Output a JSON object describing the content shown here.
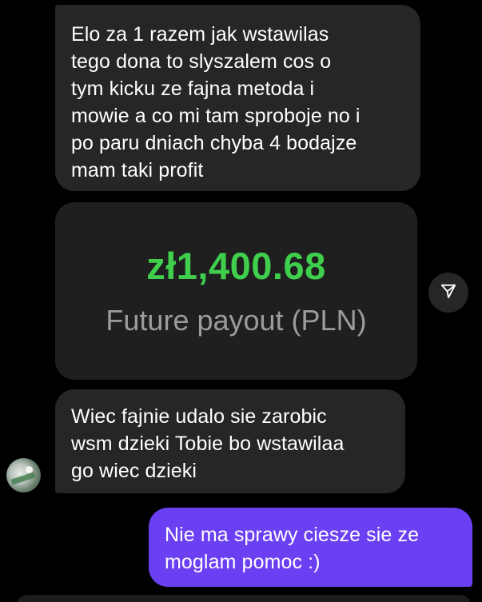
{
  "messages": [
    {
      "direction": "incoming",
      "lines": [
        "Elo za 1 razem jak wstawilas",
        "tego dona to slyszalem cos o",
        "tym kicku ze fajna metoda i",
        "mowie a co mi tam sproboje no i",
        "po paru dniach chyba 4 bodajze",
        "mam taki profit"
      ]
    },
    {
      "direction": "incoming",
      "lines": [
        "Wiec fajnie udalo sie zarobic",
        "wsm dzieki Tobie bo wstawilaa",
        "go wiec dzieki"
      ]
    },
    {
      "direction": "outgoing",
      "lines": [
        "Nie ma sprawy ciesze sie ze",
        "moglam pomoc :)"
      ]
    }
  ],
  "payout_card": {
    "amount": "zł1,400.68",
    "label": "Future payout (PLN)"
  },
  "icons": {
    "share": "paper-plane-icon",
    "avatar": "sender-avatar"
  },
  "colors": {
    "background": "#000000",
    "incoming_bubble": "#262626",
    "outgoing_bubble": "#6a40f2",
    "amount_green": "#3fcf4c",
    "label_gray": "#9c9c9c"
  }
}
